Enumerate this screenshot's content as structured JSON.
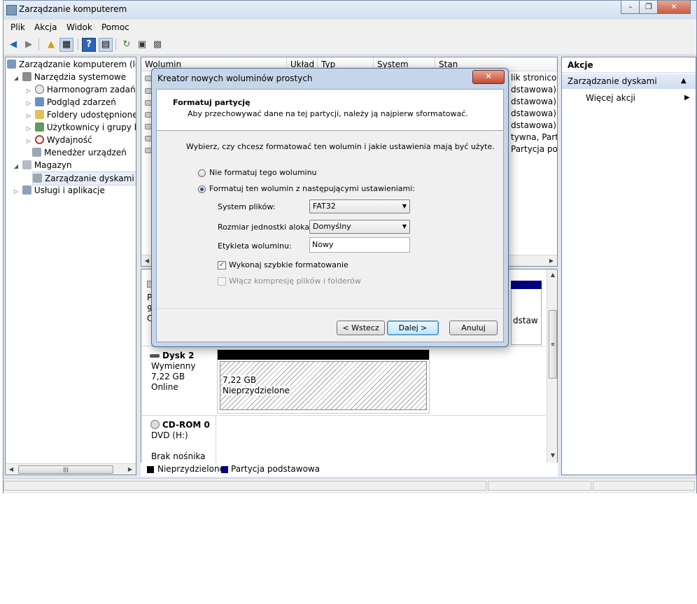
{
  "window": {
    "title": "Zarządzanie komputerem",
    "caption_minimize": "–",
    "caption_restore": "❐",
    "caption_close": "✕"
  },
  "menu": [
    "Plik",
    "Akcja",
    "Widok",
    "Pomoc"
  ],
  "toolbar": {
    "back": "◀",
    "forward": "▶",
    "up": "▲",
    "show_tree": "▦",
    "help": "?",
    "console": "▤",
    "refresh": "↻",
    "properties": "▣",
    "export": "▩"
  },
  "tree": {
    "root": "Zarządzanie komputerem (lokalne)",
    "system_tools": "Narzędzia systemowe",
    "task_scheduler": "Harmonogram zadań",
    "event_viewer": "Podgląd zdarzeń",
    "shared_folders": "Foldery udostępnione",
    "users_groups": "Użytkownicy i grupy lokalne",
    "performance": "Wydajność",
    "device_manager": "Menedżer urządzeń",
    "storage": "Magazyn",
    "disk_management": "Zarządzanie dyskami",
    "services_apps": "Usługi i aplikacje"
  },
  "volume_list": {
    "columns": [
      "Wolumin",
      "Układ",
      "Typ",
      "System plików",
      "Stan"
    ],
    "visible_fragments": [
      "lik stronicow",
      "dstawowa)",
      "dstawowa)",
      "dstawowa)",
      "dstawowa)",
      "tywna, Party",
      "Partycja pods"
    ]
  },
  "disks": {
    "partial_labels": [
      "P",
      "9",
      "O"
    ],
    "partial_right": "dstaw",
    "disk2": {
      "name": "Dysk 2",
      "type": "Wymienny",
      "size": "7,22 GB",
      "status": "Online",
      "region_size": "7,22 GB",
      "region_label": "Nieprzydzielone"
    },
    "cdrom": {
      "name": "CD-ROM 0",
      "drive": "DVD (H:)",
      "media": "Brak nośnika"
    }
  },
  "legend": {
    "unallocated": "Nieprzydzielone",
    "primary": "Partycja podstawowa",
    "unallocated_color": "#000000",
    "primary_color": "#000080"
  },
  "actions": {
    "header": "Akcje",
    "section": "Zarządzanie dyskami",
    "more": "Więcej akcji"
  },
  "dialog": {
    "title": "Kreator nowych woluminów prostych",
    "close": "✕",
    "heading": "Formatuj partycję",
    "subheading": "Aby przechowywać dane na tej partycji, należy ją najpierw sformatować.",
    "question": "Wybierz, czy chcesz formatować ten wolumin i jakie ustawienia mają być użyte.",
    "option_no_format": "Nie formatuj tego woluminu",
    "option_format": "Formatuj ten wolumin z następującymi ustawieniami:",
    "fs_label": "System plików:",
    "fs_value": "FAT32",
    "alloc_label": "Rozmiar jednostki alokacji:",
    "alloc_value": "Domyślny",
    "volume_label_label": "Etykieta woluminu:",
    "volume_label_value": "Nowy",
    "quick_format": "Wykonaj szybkie formatowanie",
    "compression": "Włącz kompresję plików i folderów",
    "back": "< Wstecz",
    "next": "Dalej >",
    "cancel": "Anuluj"
  }
}
